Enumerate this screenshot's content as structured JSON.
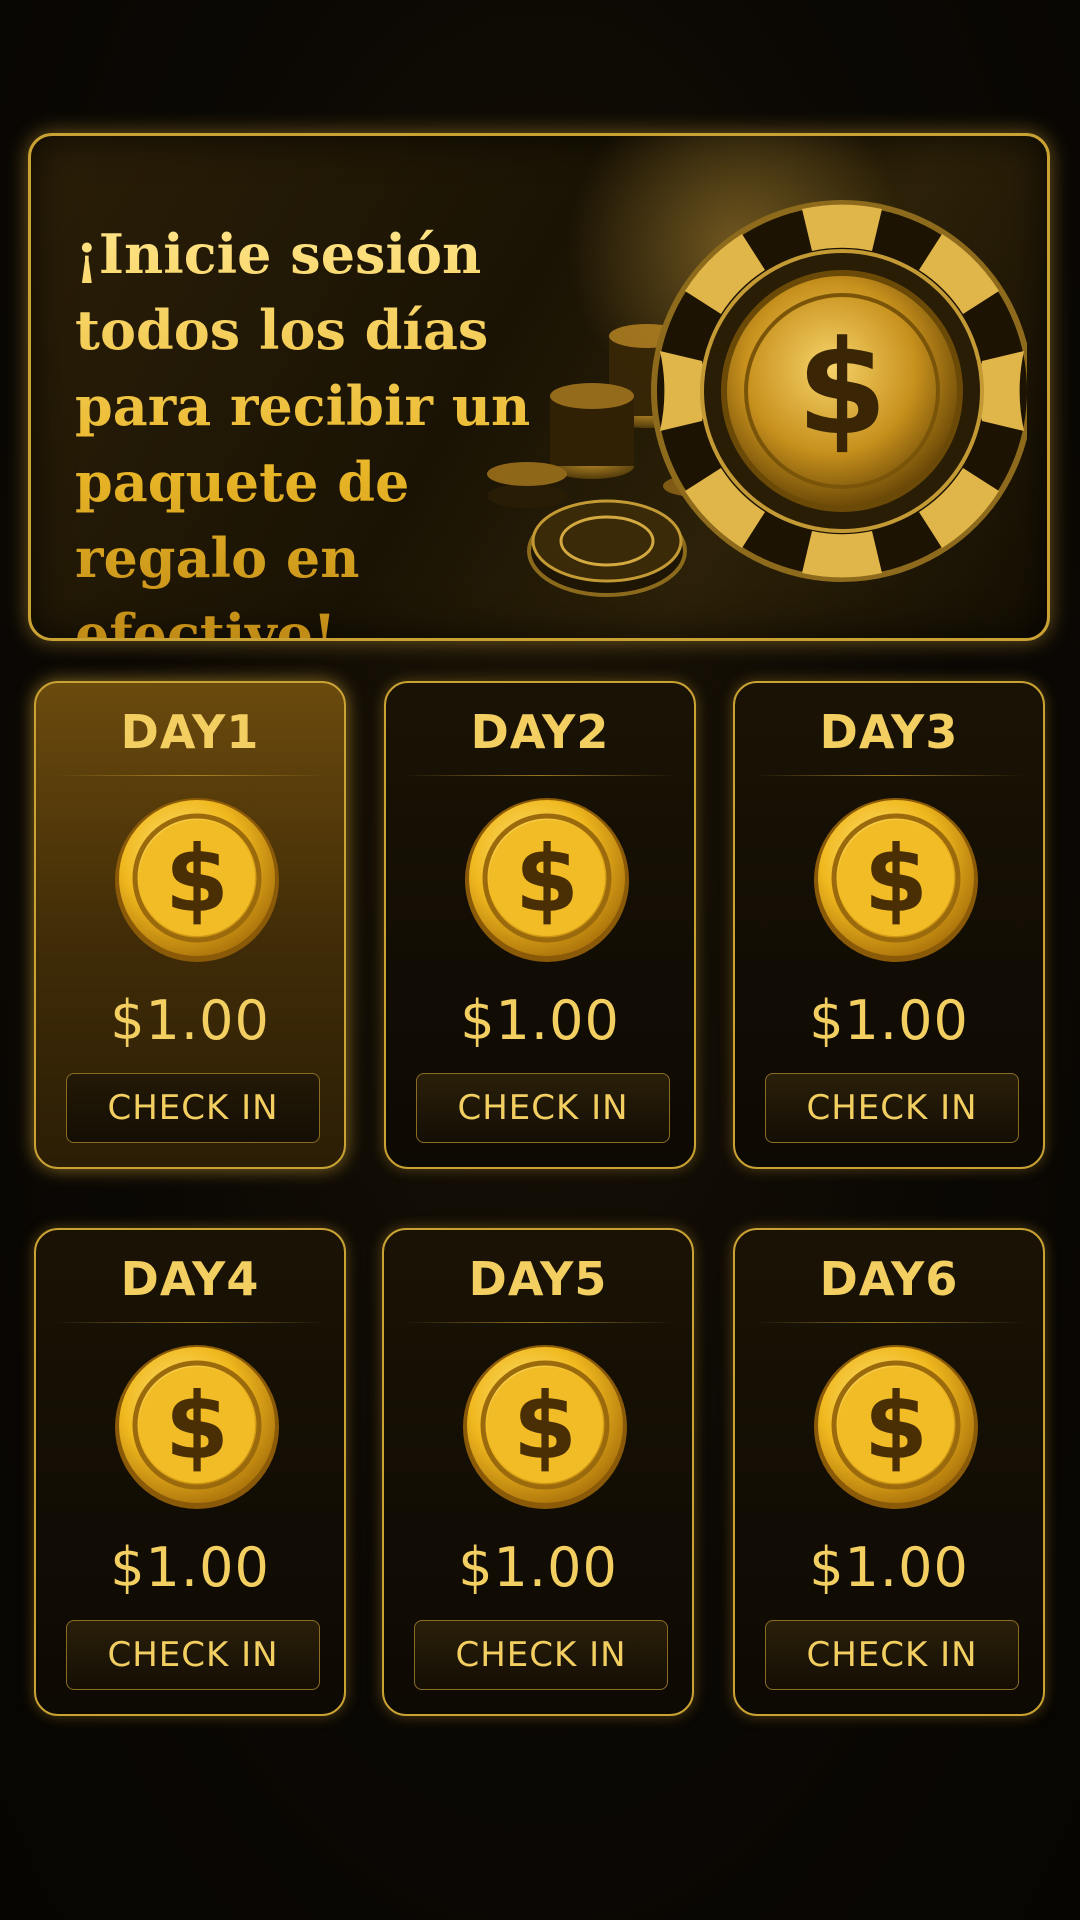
{
  "banner": {
    "text": "¡Inicie sesión todos los días para recibir un paquete de regalo en efectivo!",
    "symbol": "$"
  },
  "days": [
    {
      "title": "DAY1",
      "amount": "$1.00",
      "button": "CHECK IN",
      "active": true
    },
    {
      "title": "DAY2",
      "amount": "$1.00",
      "button": "CHECK IN",
      "active": false
    },
    {
      "title": "DAY3",
      "amount": "$1.00",
      "button": "CHECK IN",
      "active": false
    },
    {
      "title": "DAY4",
      "amount": "$1.00",
      "button": "CHECK IN",
      "active": false
    },
    {
      "title": "DAY5",
      "amount": "$1.00",
      "button": "CHECK IN",
      "active": false
    },
    {
      "title": "DAY6",
      "amount": "$1.00",
      "button": "CHECK IN",
      "active": false
    }
  ],
  "coin_symbol": "$",
  "colors": {
    "gold": "#f3cf62",
    "border": "#c9a233",
    "background": "#0b0804"
  }
}
